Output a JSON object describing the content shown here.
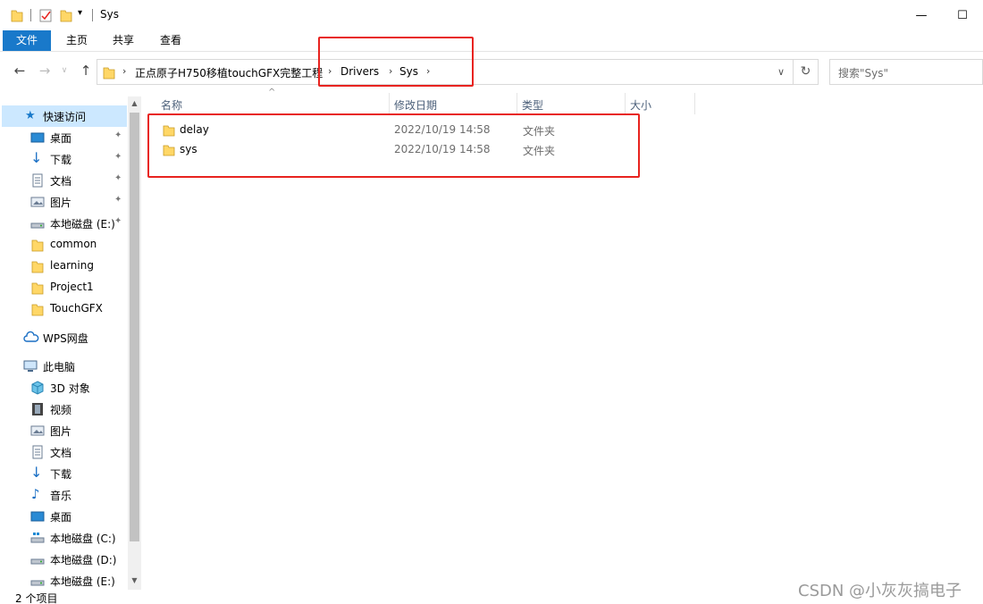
{
  "window": {
    "title": "Sys",
    "minimize_glyph": "—",
    "maximize_glyph": "☐"
  },
  "ribbon": {
    "tabs": [
      "文件",
      "主页",
      "共享",
      "查看"
    ]
  },
  "nav": {
    "back": "←",
    "forward": "→",
    "up": "↑",
    "recent": "∨"
  },
  "address": {
    "crumbs": [
      "正点原子H750移植touchGFX完整工程",
      "Drivers",
      "Sys"
    ],
    "dropdown_glyph": "∨",
    "refresh_glyph": "↻"
  },
  "search": {
    "placeholder": "搜索\"Sys\""
  },
  "sidebar": {
    "quick_access": "快速访问",
    "quick_items": [
      "桌面",
      "下载",
      "文档",
      "图片",
      "本地磁盘 (E:)",
      "common",
      "learning",
      "Project1",
      "TouchGFX"
    ],
    "wps": "WPS网盘",
    "this_pc": "此电脑",
    "pc_items": [
      "3D 对象",
      "视频",
      "图片",
      "文档",
      "下载",
      "音乐",
      "桌面",
      "本地磁盘 (C:)",
      "本地磁盘 (D:)",
      "本地磁盘 (E:)"
    ],
    "pin_glyph": "📌"
  },
  "columns": [
    "名称",
    "修改日期",
    "类型",
    "大小"
  ],
  "files": [
    {
      "name": "delay",
      "date": "2022/10/19 14:58",
      "type": "文件夹"
    },
    {
      "name": "sys",
      "date": "2022/10/19 14:58",
      "type": "文件夹"
    }
  ],
  "status": "2 个项目",
  "watermark": "CSDN @小灰灰搞电子",
  "colors": {
    "accent": "#1979ca",
    "highlight": "#e8231f",
    "selection": "#cce8ff",
    "folder": "#ffd767"
  }
}
